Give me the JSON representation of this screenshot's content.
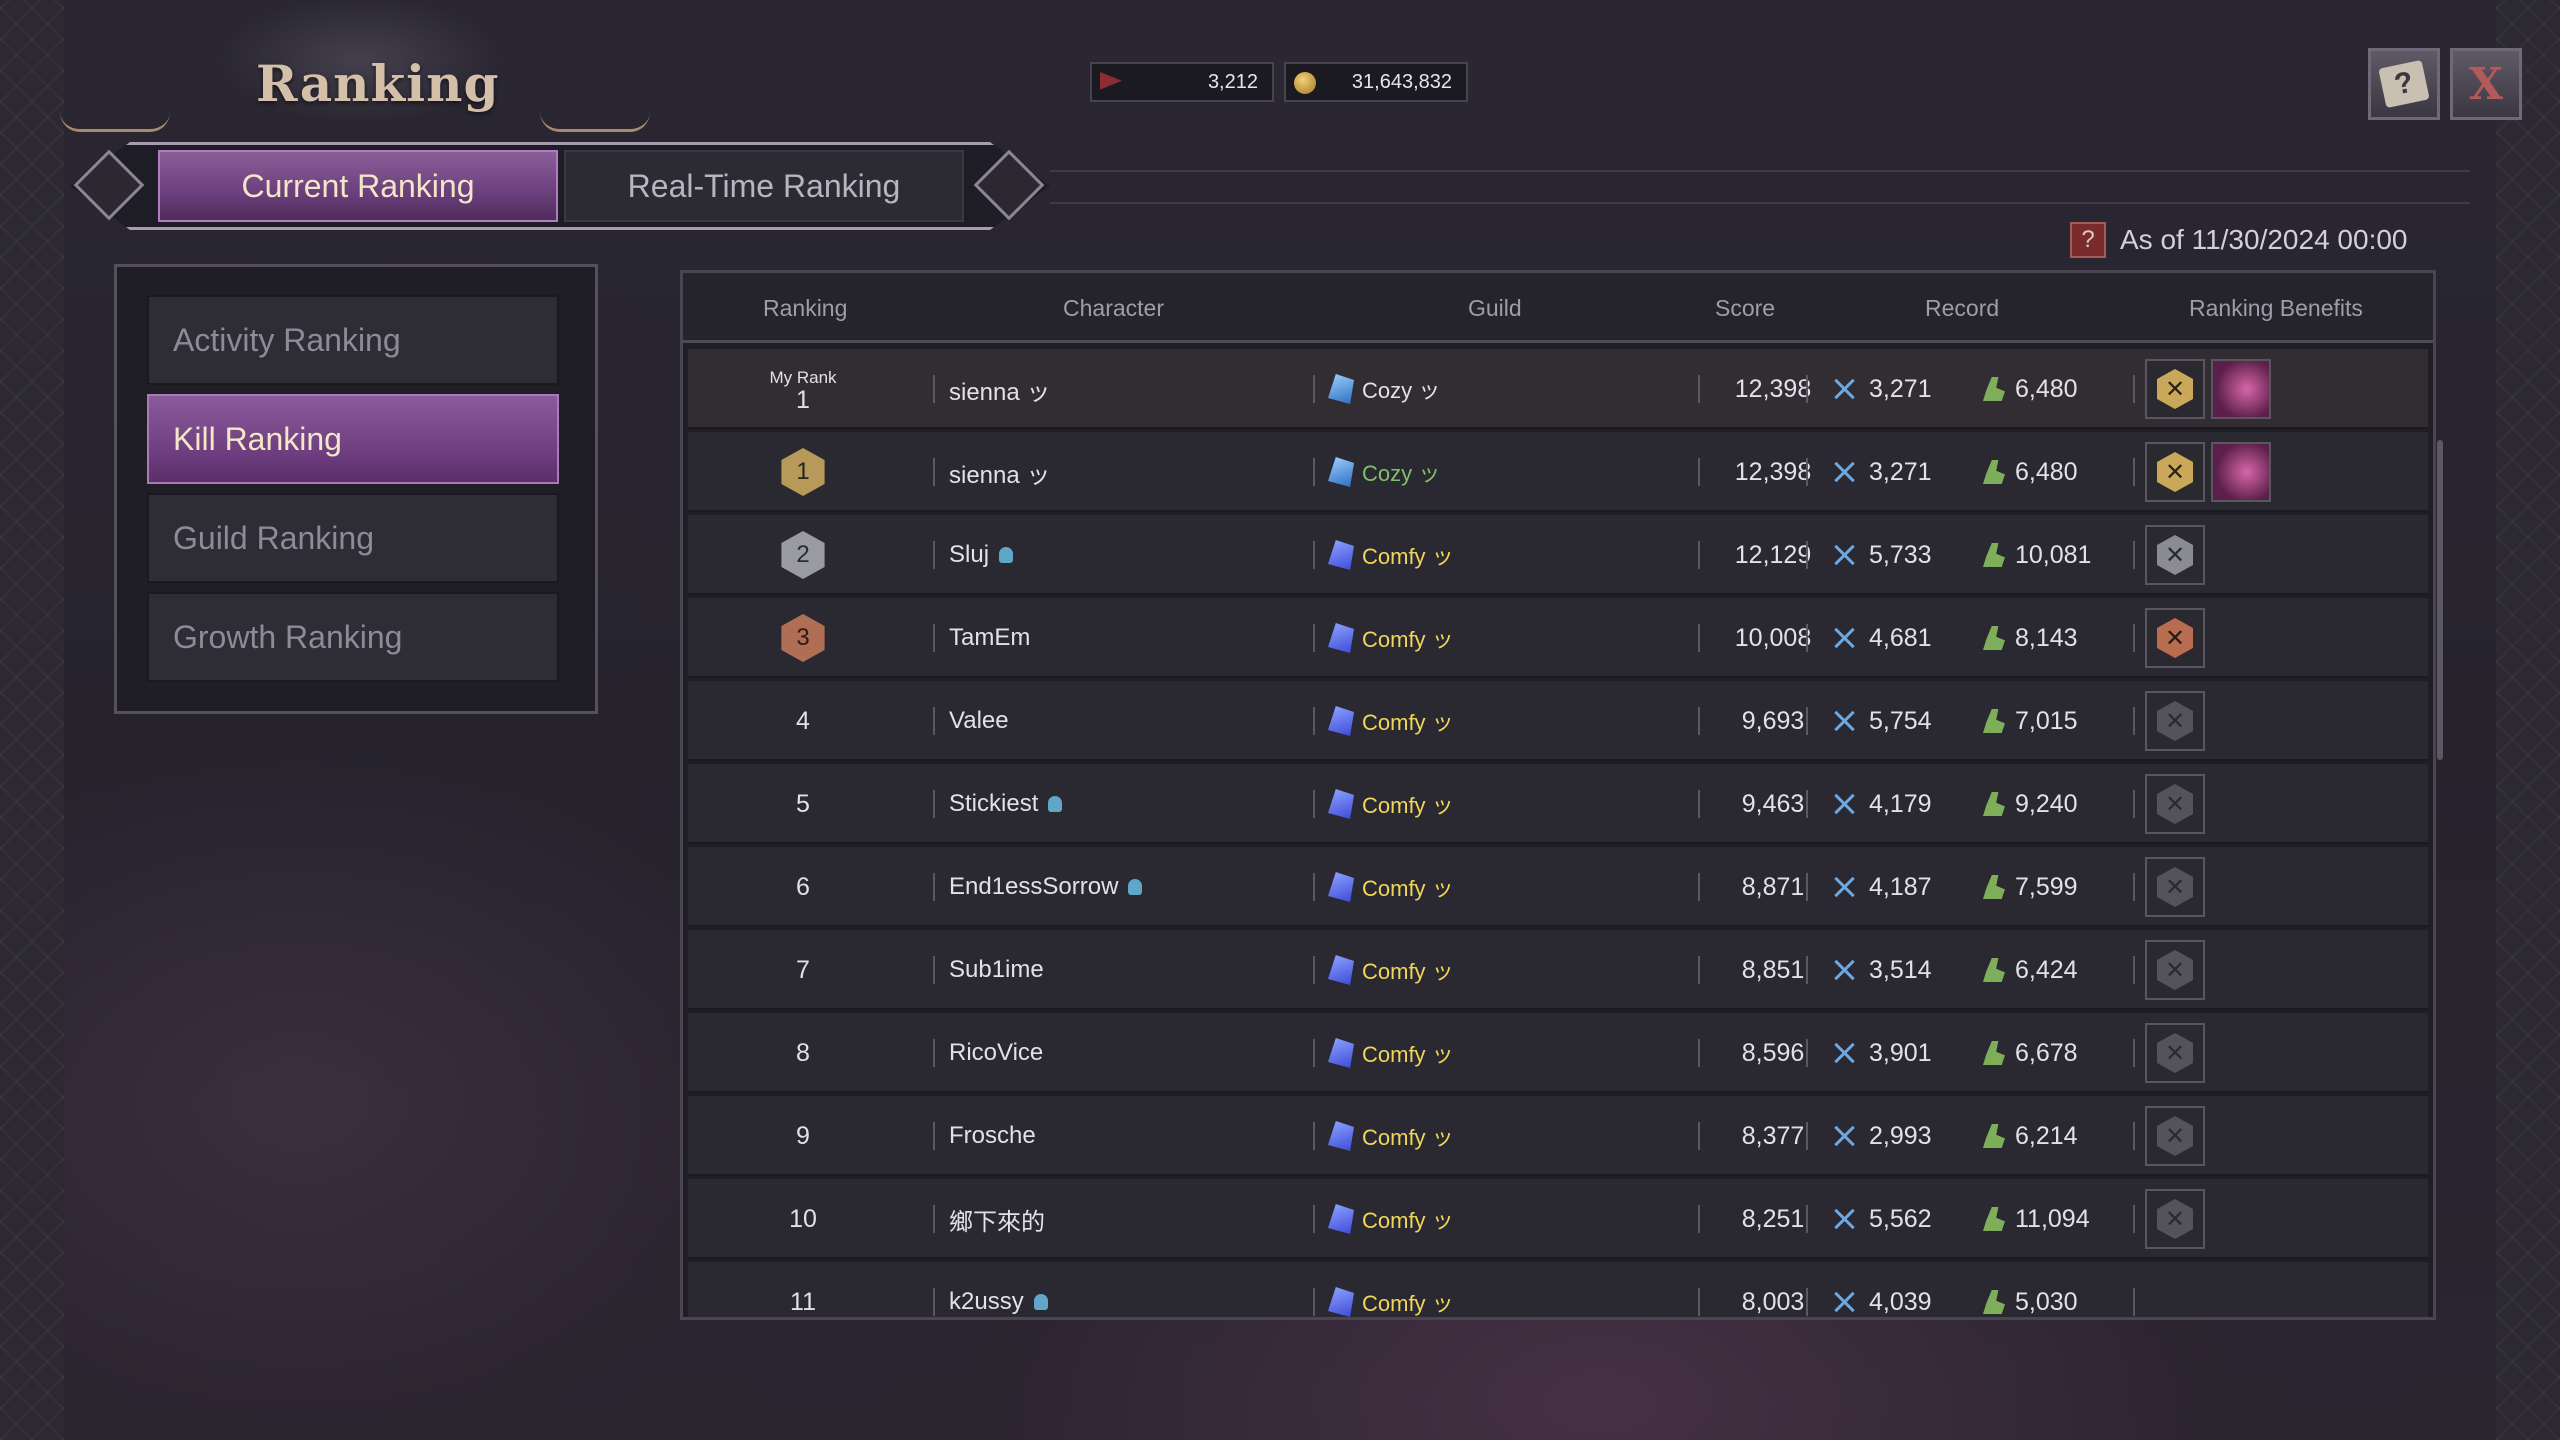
{
  "header": {
    "title": "Ranking",
    "currencies": [
      {
        "icon": "flag-ticket-icon",
        "value": "3,212"
      },
      {
        "icon": "gold-coin-icon",
        "value": "31,643,832"
      }
    ],
    "help_icon": "guide-book-icon",
    "close_label": "X"
  },
  "tabs": [
    {
      "label": "Current Ranking",
      "active": true
    },
    {
      "label": "Real-Time Ranking",
      "active": false
    }
  ],
  "sidebar": {
    "items": [
      {
        "label": "Activity Ranking",
        "active": false
      },
      {
        "label": "Kill Ranking",
        "active": true
      },
      {
        "label": "Guild Ranking",
        "active": false
      },
      {
        "label": "Growth Ranking",
        "active": false
      }
    ]
  },
  "as_of": {
    "help": "?",
    "text": "As of 11/30/2024 00:00"
  },
  "table": {
    "columns": [
      "Ranking",
      "Character",
      "Guild",
      "Score",
      "Record",
      "Ranking Benefits"
    ],
    "my_rank": {
      "label": "My Rank",
      "rank": "1",
      "character": "sienna ッ",
      "guild": "Cozy ッ",
      "score": "12,398",
      "kills": "3,271",
      "assists": "6,480",
      "benefits": [
        "gold-rank-emblem-icon",
        "crescent-moon-icon"
      ]
    },
    "rows": [
      {
        "rank": "1",
        "badge": "gold",
        "character": "sienna ッ",
        "party": false,
        "guild": "Cozy ッ",
        "guild_color": "green",
        "score": "12,398",
        "kills": "3,271",
        "assists": "6,480",
        "benefits": [
          "gold",
          "moon"
        ]
      },
      {
        "rank": "2",
        "badge": "silver",
        "character": "Sluj",
        "party": true,
        "guild": "Comfy ッ",
        "guild_color": "yellow",
        "score": "12,129",
        "kills": "5,733",
        "assists": "10,081",
        "benefits": [
          "silver"
        ]
      },
      {
        "rank": "3",
        "badge": "bronze",
        "character": "TamEm",
        "party": false,
        "guild": "Comfy ッ",
        "guild_color": "yellow",
        "score": "10,008",
        "kills": "4,681",
        "assists": "8,143",
        "benefits": [
          "bronze"
        ]
      },
      {
        "rank": "4",
        "badge": "",
        "character": "Valee",
        "party": false,
        "guild": "Comfy ッ",
        "guild_color": "yellow",
        "score": "9,693",
        "kills": "5,754",
        "assists": "7,015",
        "benefits": [
          "grey"
        ]
      },
      {
        "rank": "5",
        "badge": "",
        "character": "Stickiest",
        "party": true,
        "guild": "Comfy ッ",
        "guild_color": "yellow",
        "score": "9,463",
        "kills": "4,179",
        "assists": "9,240",
        "benefits": [
          "grey"
        ]
      },
      {
        "rank": "6",
        "badge": "",
        "character": "End1essSorrow",
        "party": true,
        "guild": "Comfy ッ",
        "guild_color": "yellow",
        "score": "8,871",
        "kills": "4,187",
        "assists": "7,599",
        "benefits": [
          "grey"
        ]
      },
      {
        "rank": "7",
        "badge": "",
        "character": "Sub1ime",
        "party": false,
        "guild": "Comfy ッ",
        "guild_color": "yellow",
        "score": "8,851",
        "kills": "3,514",
        "assists": "6,424",
        "benefits": [
          "grey"
        ]
      },
      {
        "rank": "8",
        "badge": "",
        "character": "RicoVice",
        "party": false,
        "guild": "Comfy ッ",
        "guild_color": "yellow",
        "score": "8,596",
        "kills": "3,901",
        "assists": "6,678",
        "benefits": [
          "grey"
        ]
      },
      {
        "rank": "9",
        "badge": "",
        "character": "Frosche",
        "party": false,
        "guild": "Comfy ッ",
        "guild_color": "yellow",
        "score": "8,377",
        "kills": "2,993",
        "assists": "6,214",
        "benefits": [
          "grey"
        ]
      },
      {
        "rank": "10",
        "badge": "",
        "character": "鄉下來的",
        "party": false,
        "guild": "Comfy ッ",
        "guild_color": "yellow",
        "score": "8,251",
        "kills": "5,562",
        "assists": "11,094",
        "benefits": [
          "grey"
        ]
      },
      {
        "rank": "11",
        "badge": "",
        "character": "k2ussy",
        "party": true,
        "guild": "Comfy ッ",
        "guild_color": "yellow",
        "score": "8,003",
        "kills": "4,039",
        "assists": "5,030",
        "benefits": []
      }
    ]
  },
  "colors": {
    "accent_purple": "#7a4a8c",
    "guild_yellow": "#f0d65a",
    "guild_green": "#7fc06a",
    "kill_blue": "#6da8e0",
    "assist_green": "#7fae5a"
  }
}
